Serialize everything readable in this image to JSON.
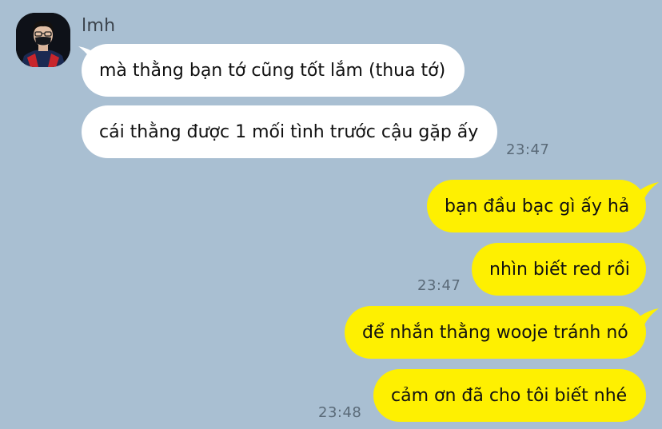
{
  "theme": {
    "background": "#a9bfd2",
    "incoming_bubble": "#ffffff",
    "outgoing_bubble": "#fef001"
  },
  "sender": {
    "name": "lmh",
    "avatar_icon": "profile-photo-icon"
  },
  "messages": {
    "incoming": [
      {
        "text": "mà thằng bạn tớ cũng tốt lắm (thua tớ)"
      },
      {
        "text": "cái thằng được 1 mối tình trước cậu gặp ấy",
        "time": "23:47"
      }
    ],
    "outgoing": [
      {
        "text": "bạn đầu bạc gì ấy hả"
      },
      {
        "text": "nhìn biết red rồi",
        "time": "23:47"
      },
      {
        "text": "để nhắn thằng wooje tránh nó"
      },
      {
        "text": "cảm ơn đã cho tôi biết nhé",
        "time": "23:48"
      }
    ]
  }
}
